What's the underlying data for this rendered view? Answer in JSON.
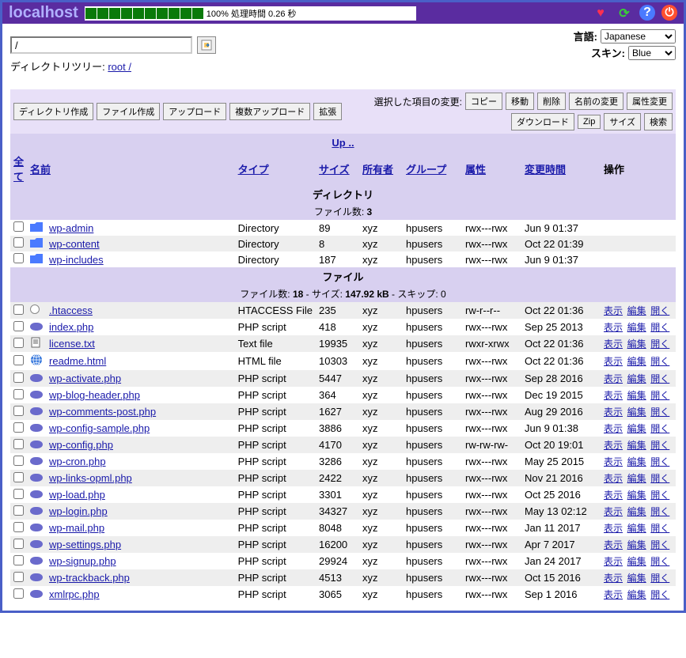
{
  "host": "localhost",
  "progress": {
    "percent": "100%",
    "timing": "処理時間 0.26 秒"
  },
  "lang_label": "言語:",
  "lang_value": "Japanese",
  "skin_label": "スキン:",
  "skin_value": "Blue",
  "path_value": "/",
  "tree_prefix": "ディレクトリツリー: ",
  "tree_path": "root /",
  "toolbar": {
    "mkdir": "ディレクトリ作成",
    "mkfile": "ファイル作成",
    "upload": "アップロード",
    "multi_upload": "複数アップロード",
    "ext": "拡張"
  },
  "selected_label": "選択した項目の変更:",
  "ops_row1": {
    "copy": "コピー",
    "move": "移動",
    "delete": "削除",
    "rename": "名前の変更",
    "chmod": "属性変更"
  },
  "ops_row2": {
    "download": "ダウンロード",
    "zip": "Zip",
    "size": "サイズ",
    "search": "検索"
  },
  "up_label": "Up ..",
  "headers": {
    "all": "全て",
    "name": "名前",
    "type": "タイプ",
    "size": "サイズ",
    "owner": "所有者",
    "group": "グループ",
    "perms": "属性",
    "mtime": "変更時間",
    "actions": "操作"
  },
  "dir_section": "ディレクトリ",
  "dir_count_label": "ファイル数:",
  "dir_count": "3",
  "file_section": "ファイル",
  "file_count_label": "ファイル数:",
  "file_count": "18",
  "file_size_label": "サイズ:",
  "file_total_size": "147.92 kB",
  "file_skip_label": "スキップ:",
  "file_skip": "0",
  "action_view": "表示",
  "action_edit": "編集",
  "action_open": "開く",
  "dirs": [
    {
      "name": "wp-admin",
      "type": "Directory",
      "size": "89",
      "owner": "xyz",
      "group": "hpusers",
      "perms": "rwx---rwx",
      "mtime": "Jun 9 01:37"
    },
    {
      "name": "wp-content",
      "type": "Directory",
      "size": "8",
      "owner": "xyz",
      "group": "hpusers",
      "perms": "rwx---rwx",
      "mtime": "Oct 22 01:39"
    },
    {
      "name": "wp-includes",
      "type": "Directory",
      "size": "187",
      "owner": "xyz",
      "group": "hpusers",
      "perms": "rwx---rwx",
      "mtime": "Jun 9 01:37"
    }
  ],
  "files": [
    {
      "name": ".htaccess",
      "type": "HTACCESS File",
      "size": "235",
      "owner": "xyz",
      "group": "hpusers",
      "perms": "rw-r--r--",
      "mtime": "Oct 22 01:36",
      "icon": "blank"
    },
    {
      "name": "index.php",
      "type": "PHP script",
      "size": "418",
      "owner": "xyz",
      "group": "hpusers",
      "perms": "rwx---rwx",
      "mtime": "Sep 25 2013",
      "icon": "php"
    },
    {
      "name": "license.txt",
      "type": "Text file",
      "size": "19935",
      "owner": "xyz",
      "group": "hpusers",
      "perms": "rwxr-xrwx",
      "mtime": "Oct 22 01:36",
      "icon": "txt"
    },
    {
      "name": "readme.html",
      "type": "HTML file",
      "size": "10303",
      "owner": "xyz",
      "group": "hpusers",
      "perms": "rwx---rwx",
      "mtime": "Oct 22 01:36",
      "icon": "html"
    },
    {
      "name": "wp-activate.php",
      "type": "PHP script",
      "size": "5447",
      "owner": "xyz",
      "group": "hpusers",
      "perms": "rwx---rwx",
      "mtime": "Sep 28 2016",
      "icon": "php"
    },
    {
      "name": "wp-blog-header.php",
      "type": "PHP script",
      "size": "364",
      "owner": "xyz",
      "group": "hpusers",
      "perms": "rwx---rwx",
      "mtime": "Dec 19 2015",
      "icon": "php"
    },
    {
      "name": "wp-comments-post.php",
      "type": "PHP script",
      "size": "1627",
      "owner": "xyz",
      "group": "hpusers",
      "perms": "rwx---rwx",
      "mtime": "Aug 29 2016",
      "icon": "php"
    },
    {
      "name": "wp-config-sample.php",
      "type": "PHP script",
      "size": "3886",
      "owner": "xyz",
      "group": "hpusers",
      "perms": "rwx---rwx",
      "mtime": "Jun 9 01:38",
      "icon": "php"
    },
    {
      "name": "wp-config.php",
      "type": "PHP script",
      "size": "4170",
      "owner": "xyz",
      "group": "hpusers",
      "perms": "rw-rw-rw-",
      "mtime": "Oct 20 19:01",
      "icon": "php"
    },
    {
      "name": "wp-cron.php",
      "type": "PHP script",
      "size": "3286",
      "owner": "xyz",
      "group": "hpusers",
      "perms": "rwx---rwx",
      "mtime": "May 25 2015",
      "icon": "php"
    },
    {
      "name": "wp-links-opml.php",
      "type": "PHP script",
      "size": "2422",
      "owner": "xyz",
      "group": "hpusers",
      "perms": "rwx---rwx",
      "mtime": "Nov 21 2016",
      "icon": "php"
    },
    {
      "name": "wp-load.php",
      "type": "PHP script",
      "size": "3301",
      "owner": "xyz",
      "group": "hpusers",
      "perms": "rwx---rwx",
      "mtime": "Oct 25 2016",
      "icon": "php"
    },
    {
      "name": "wp-login.php",
      "type": "PHP script",
      "size": "34327",
      "owner": "xyz",
      "group": "hpusers",
      "perms": "rwx---rwx",
      "mtime": "May 13 02:12",
      "icon": "php"
    },
    {
      "name": "wp-mail.php",
      "type": "PHP script",
      "size": "8048",
      "owner": "xyz",
      "group": "hpusers",
      "perms": "rwx---rwx",
      "mtime": "Jan 11 2017",
      "icon": "php"
    },
    {
      "name": "wp-settings.php",
      "type": "PHP script",
      "size": "16200",
      "owner": "xyz",
      "group": "hpusers",
      "perms": "rwx---rwx",
      "mtime": "Apr 7 2017",
      "icon": "php"
    },
    {
      "name": "wp-signup.php",
      "type": "PHP script",
      "size": "29924",
      "owner": "xyz",
      "group": "hpusers",
      "perms": "rwx---rwx",
      "mtime": "Jan 24 2017",
      "icon": "php"
    },
    {
      "name": "wp-trackback.php",
      "type": "PHP script",
      "size": "4513",
      "owner": "xyz",
      "group": "hpusers",
      "perms": "rwx---rwx",
      "mtime": "Oct 15 2016",
      "icon": "php"
    },
    {
      "name": "xmlrpc.php",
      "type": "PHP script",
      "size": "3065",
      "owner": "xyz",
      "group": "hpusers",
      "perms": "rwx---rwx",
      "mtime": "Sep 1 2016",
      "icon": "php"
    }
  ]
}
